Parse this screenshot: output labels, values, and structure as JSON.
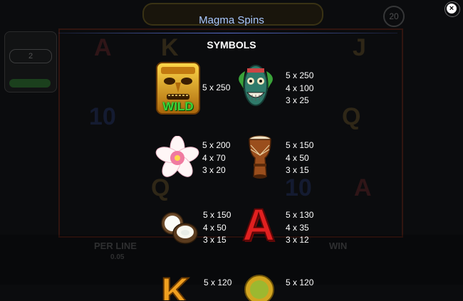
{
  "header": {
    "title": "Magma Spins",
    "close_label": "×"
  },
  "background": {
    "game_logo_text": "MAGMA SPINS",
    "spins_badge": "20",
    "left_panel_value": "2",
    "bottom": {
      "per_line": "PER LINE",
      "line_value": "0.05",
      "win": "WIN"
    },
    "reel_letters": [
      "A",
      "K",
      "J",
      "Q",
      "10",
      "10",
      "Q",
      "A"
    ]
  },
  "symbols_section": {
    "heading": "SYMBOLS",
    "items": [
      {
        "icon": "wild-tiki-icon",
        "label": "WILD",
        "pays": [
          "5 x 250"
        ]
      },
      {
        "icon": "green-tiki-mask-icon",
        "pays": [
          "5 x 250",
          "4 x 100",
          "3 x 25"
        ]
      },
      {
        "icon": "hibiscus-flower-icon",
        "pays": [
          "5 x 200",
          "4 x 70",
          "3 x 20"
        ]
      },
      {
        "icon": "tribal-drum-icon",
        "pays": [
          "5 x 150",
          "4 x 50",
          "3 x 15"
        ]
      },
      {
        "icon": "coconut-icon",
        "pays": [
          "5 x 150",
          "4 x 50",
          "3 x 15"
        ]
      },
      {
        "icon": "letter-a-icon",
        "label": "A",
        "pays": [
          "5 x 130",
          "4 x 35",
          "3 x 12"
        ]
      },
      {
        "icon": "letter-k-icon",
        "label": "K",
        "pays": [
          "5 x 120"
        ]
      },
      {
        "icon": "gold-coin-icon",
        "pays": [
          "5 x 120"
        ]
      }
    ]
  },
  "colors": {
    "title": "#a8c8ff",
    "accent_line": "#5a6fd0",
    "background": "#0b0c0e"
  }
}
